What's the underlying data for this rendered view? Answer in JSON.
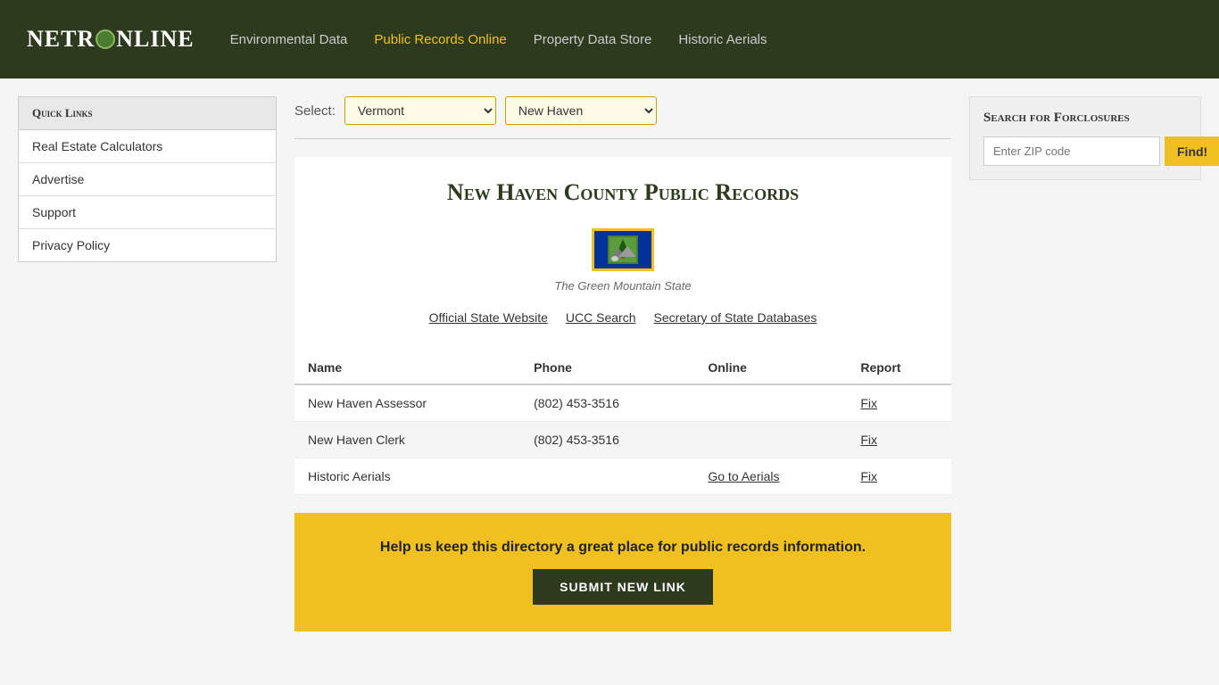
{
  "header": {
    "logo": "NETRONLINE",
    "nav": [
      {
        "label": "Environmental Data",
        "active": false
      },
      {
        "label": "Public Records Online",
        "active": true
      },
      {
        "label": "Property Data Store",
        "active": false
      },
      {
        "label": "Historic Aerials",
        "active": false
      }
    ]
  },
  "sidebar": {
    "title": "Quick Links",
    "items": [
      {
        "label": "Real Estate Calculators"
      },
      {
        "label": "Advertise"
      },
      {
        "label": "Support"
      },
      {
        "label": "Privacy Policy"
      }
    ]
  },
  "select": {
    "label": "Select:",
    "state": "Vermont",
    "county": "New Haven",
    "state_options": [
      "Vermont"
    ],
    "county_options": [
      "New Haven"
    ]
  },
  "main": {
    "title": "New Haven County Public Records",
    "state_nickname": "The Green Mountain State",
    "links": [
      {
        "label": "Official State Website",
        "href": "#"
      },
      {
        "label": "UCC Search",
        "href": "#"
      },
      {
        "label": "Secretary of State Databases",
        "href": "#"
      }
    ],
    "table": {
      "headers": [
        "Name",
        "Phone",
        "Online",
        "Report"
      ],
      "rows": [
        {
          "name": "New Haven Assessor",
          "phone": "(802) 453-3516",
          "online": "",
          "report": "Fix"
        },
        {
          "name": "New Haven Clerk",
          "phone": "(802) 453-3516",
          "online": "",
          "report": "Fix"
        },
        {
          "name": "Historic Aerials",
          "phone": "",
          "online": "Go to Aerials",
          "report": "Fix"
        }
      ]
    },
    "banner": {
      "text": "Help us keep this directory a great place for public records information.",
      "button": "Submit New Link"
    }
  },
  "foreclosure": {
    "title": "Search for Forclosures",
    "placeholder": "Enter ZIP code",
    "button": "Find!"
  }
}
